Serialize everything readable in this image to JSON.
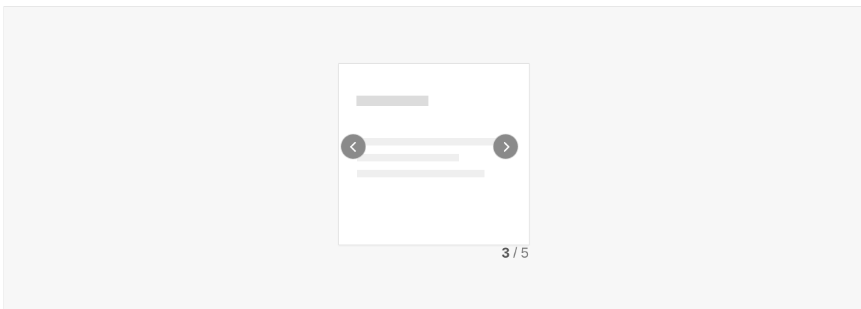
{
  "pager": {
    "current": "3",
    "separator": "/",
    "total": "5"
  },
  "controls": {
    "prev_icon": "chevron-left-icon",
    "next_icon": "chevron-right-icon",
    "button_color": "#8a8a8a"
  }
}
